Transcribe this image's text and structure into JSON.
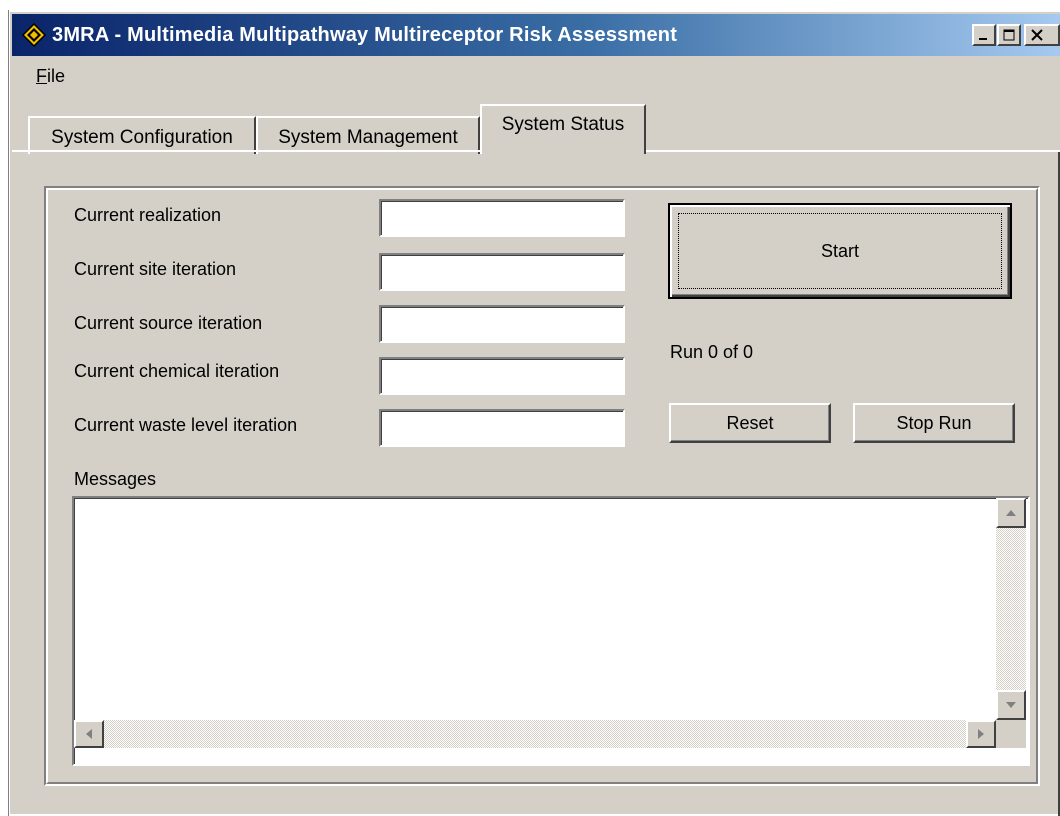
{
  "window": {
    "title": "3MRA - Multimedia Multipathway Multireceptor Risk Assessment",
    "icons": {
      "app": "diamond-app-icon",
      "minimize": "minimize-icon",
      "maximize": "maximize-icon",
      "close": "close-icon"
    }
  },
  "menu": {
    "file_label_underlined": "F",
    "file_label_rest": "ile"
  },
  "tabs": [
    {
      "label": "System Configuration",
      "active": false
    },
    {
      "label": "System Management",
      "active": false
    },
    {
      "label": "System Status",
      "active": true
    }
  ],
  "status": {
    "realization_label": "Current realization",
    "site_label": "Current site iteration",
    "source_label": "Current source iteration",
    "chemical_label": "Current chemical iteration",
    "waste_label": "Current waste level iteration",
    "realization_value": "",
    "site_value": "",
    "source_value": "",
    "chemical_value": "",
    "waste_value": ""
  },
  "controls": {
    "start_label": "Start",
    "run_text": "Run 0 of 0",
    "reset_label": "Reset",
    "stop_label": "Stop Run"
  },
  "messages": {
    "label": "Messages",
    "value": ""
  },
  "colors": {
    "face": "#d4d0c8",
    "title_start": "#0a246a",
    "title_end": "#a6caf0"
  }
}
